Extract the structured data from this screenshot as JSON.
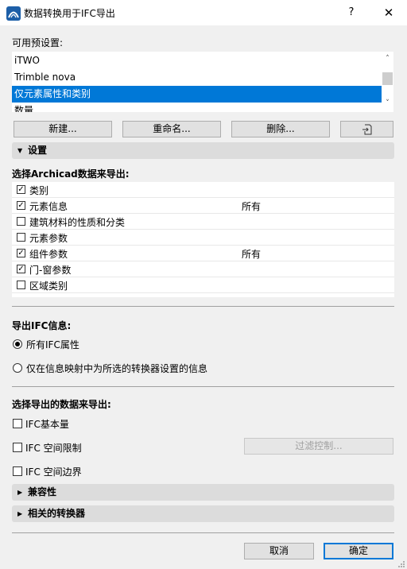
{
  "window": {
    "title": "数据转换用于IFC导出",
    "help_label": "?",
    "close_label": "✕"
  },
  "presets": {
    "label": "可用预设置:",
    "items": [
      "iTWO",
      "Trimble nova",
      "仅元素属性和类别",
      "数量"
    ],
    "selected_index": 2
  },
  "preset_buttons": {
    "new": "新建...",
    "rename": "重命名...",
    "delete": "删除..."
  },
  "settings": {
    "header": "设置",
    "select_label": "选择Archicad数据来导出:",
    "rows": [
      {
        "label": "类别",
        "checked": true,
        "value": ""
      },
      {
        "label": "元素信息",
        "checked": true,
        "value": "所有"
      },
      {
        "label": "建筑材料的性质和分类",
        "checked": false,
        "value": ""
      },
      {
        "label": "元素参数",
        "checked": false,
        "value": ""
      },
      {
        "label": "组件参数",
        "checked": true,
        "value": "所有"
      },
      {
        "label": "门-窗参数",
        "checked": true,
        "value": ""
      },
      {
        "label": "区域类别",
        "checked": false,
        "value": ""
      }
    ]
  },
  "ifc_info": {
    "label": "导出IFC信息:",
    "option_all": "所有IFC属性",
    "option_mapped": "仅在信息映射中为所选的转换器设置的信息",
    "selected": "all"
  },
  "derived": {
    "label": "选择导出的数据来导出:",
    "base_quantities": "IFC基本量",
    "space_containment": "IFC 空间限制",
    "space_boundaries": "IFC 空间边界",
    "filter_button": "过滤控制..."
  },
  "compatibility": {
    "header": "兼容性"
  },
  "related": {
    "header": "相关的转换器"
  },
  "footer": {
    "cancel": "取消",
    "ok": "确定"
  },
  "colors": {
    "selection": "#0078d7",
    "background": "#f0f0f0"
  }
}
